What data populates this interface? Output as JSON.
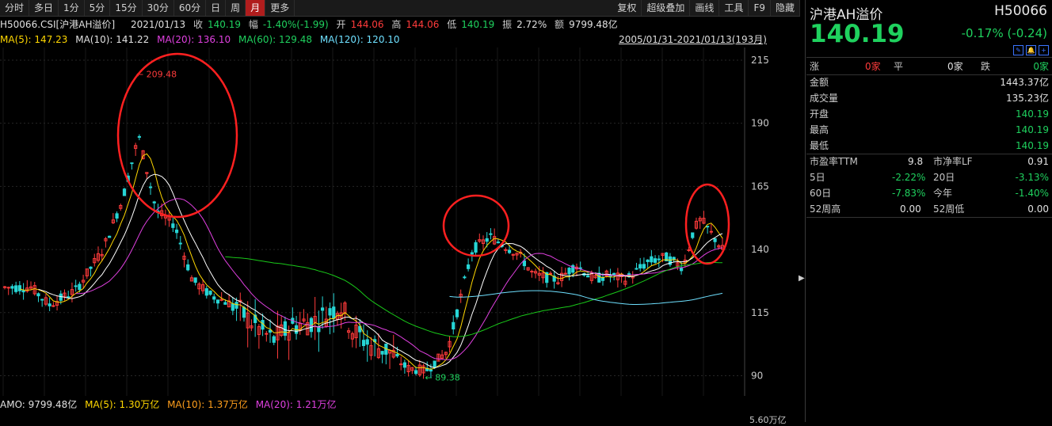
{
  "toolbar": {
    "left": [
      "分时",
      "多日",
      "1分",
      "5分",
      "15分",
      "30分",
      "60分",
      "日",
      "周",
      "月",
      "更多"
    ],
    "active": "月",
    "right": [
      "复权",
      "超级叠加",
      "画线",
      "工具",
      "F9",
      "隐藏"
    ]
  },
  "info": {
    "code": "H50066.CSI[沪港AH溢价]",
    "date": "2021/01/13",
    "close_label": "收",
    "close": "140.19",
    "amp_label": "幅",
    "amp": "-1.40%(-1.99)",
    "open_label": "开",
    "open": "144.06",
    "high_label": "高",
    "high": "144.06",
    "low_label": "低",
    "low": "140.19",
    "swing_label": "振",
    "swing": "2.72%",
    "amount_label": "额",
    "amount": "9799.48亿"
  },
  "ma": {
    "ma5": "MA(5): 147.23",
    "ma10": "MA(10): 141.22",
    "ma20": "MA(20): 136.10",
    "ma60": "MA(60): 129.48",
    "ma120": "MA(120): 120.10",
    "range": "2005/01/31-2021/01/13(193月)"
  },
  "chart_data": {
    "type": "candlestick",
    "y_ticks": [
      215,
      190,
      165,
      140,
      115,
      90
    ],
    "ylim": [
      82,
      220
    ],
    "max_annotation": "209.48",
    "min_annotation": "89.38",
    "colors": {
      "up": "#ff3b3b",
      "down": "#27d6d6",
      "ma5": "#ffd700",
      "ma10": "#ffffff",
      "ma20": "#e040e0",
      "ma60": "#19c919",
      "ma120": "#6ee0ff",
      "circle": "#ff2020"
    }
  },
  "sub": {
    "amo": "AMO: 9799.48亿",
    "ma5": "MA(5): 1.30万亿",
    "ma10": "MA(10): 1.37万亿",
    "ma20": "MA(20): 1.21万亿",
    "axis": "5.60万亿"
  },
  "panel": {
    "name": "沪港AH溢价",
    "code": "H50066",
    "price": "140.19",
    "change": "-0.17% (-0.24)",
    "icons": [
      "✎",
      "🔔",
      "+"
    ],
    "up_label": "涨",
    "up_value": "0家",
    "flat_label": "平",
    "flat_value": "0家",
    "down_label": "跌",
    "down_value": "0家",
    "rows": [
      {
        "label": "金额",
        "value": "1443.37亿"
      },
      {
        "label": "成交量",
        "value": "135.23亿"
      },
      {
        "label": "开盘",
        "value": "140.19"
      },
      {
        "label": "最高",
        "value": "140.19"
      },
      {
        "label": "最低",
        "value": "140.19"
      }
    ],
    "pe_label": "市盈率TTM",
    "pe": "9.8",
    "pb_label": "市净率LF",
    "pb": "0.91",
    "d5_label": "5日",
    "d5": "-2.22%",
    "d20_label": "20日",
    "d20": "-3.13%",
    "d60_label": "60日",
    "d60": "-7.83%",
    "ytd_label": "今年",
    "ytd": "-1.40%",
    "w52h_label": "52周高",
    "w52h": "0.00",
    "w52l_label": "52周低",
    "w52l": "0.00"
  }
}
